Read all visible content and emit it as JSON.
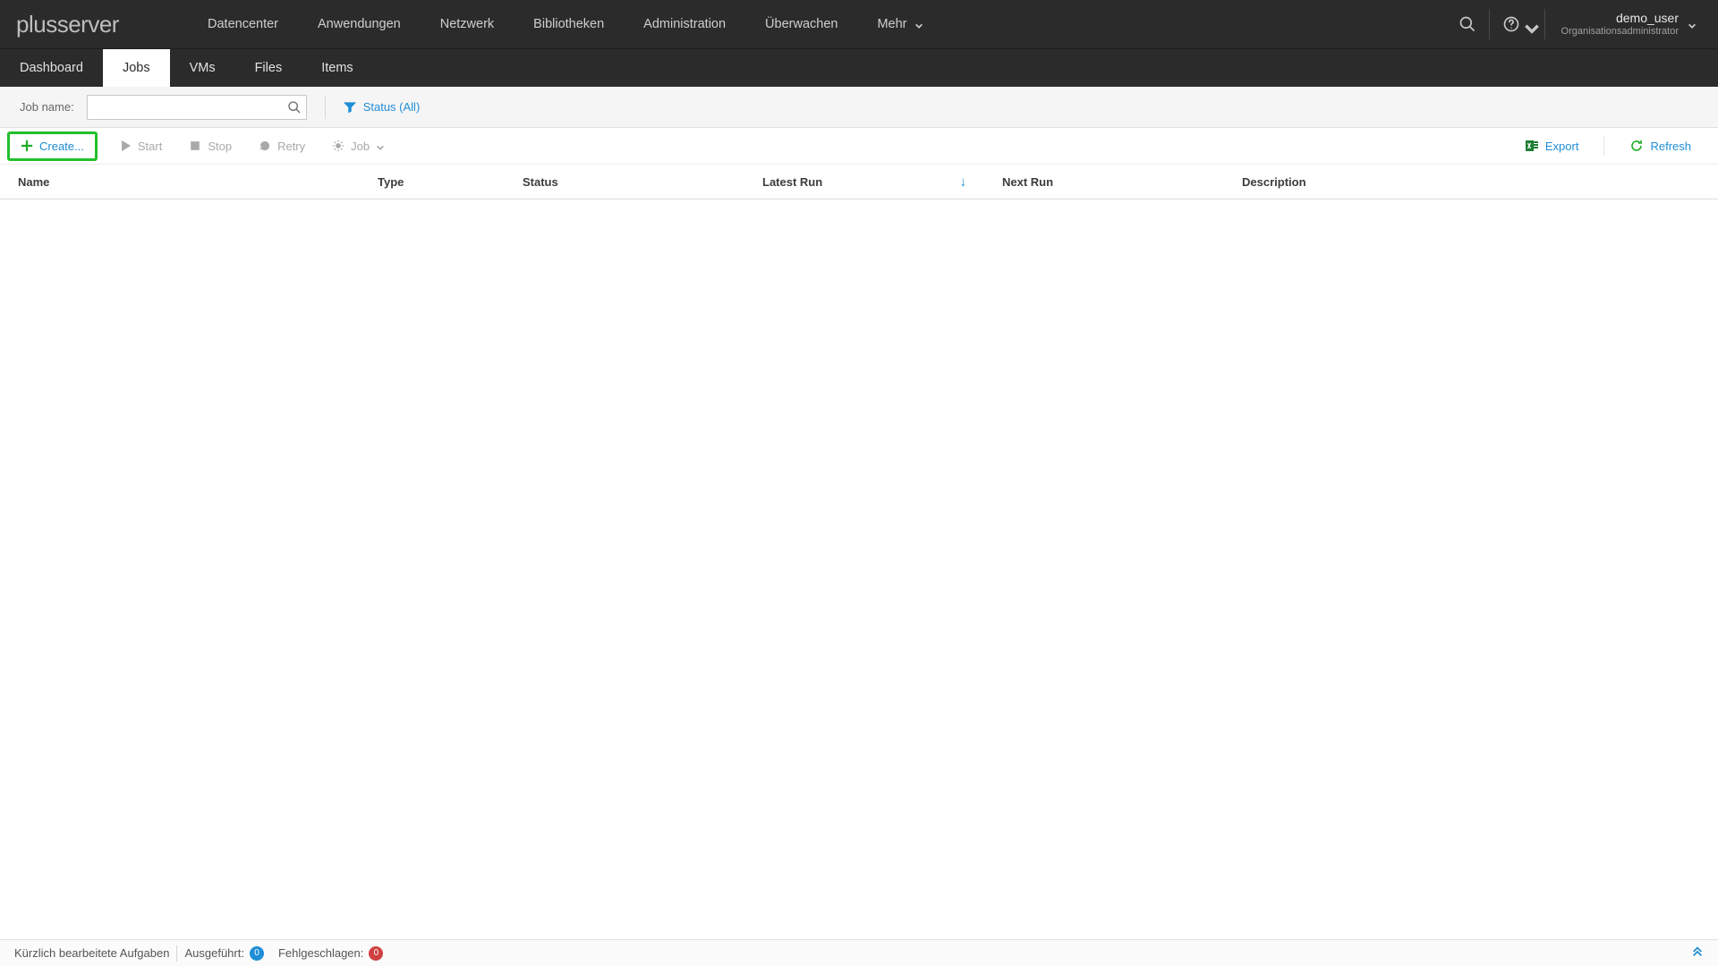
{
  "brand": "plusserver",
  "primary_nav": {
    "items": [
      "Datencenter",
      "Anwendungen",
      "Netzwerk",
      "Bibliotheken",
      "Administration",
      "Überwachen"
    ],
    "more_label": "Mehr"
  },
  "user": {
    "name": "demo_user",
    "role": "Organisationsadministrator"
  },
  "subtabs": {
    "items": [
      "Dashboard",
      "Jobs",
      "VMs",
      "Files",
      "Items"
    ],
    "active_index": 1
  },
  "filter": {
    "label": "Job name:",
    "search_value": "",
    "search_placeholder": "",
    "status_label": "Status (All)"
  },
  "toolbar": {
    "create": "Create...",
    "start": "Start",
    "stop": "Stop",
    "retry": "Retry",
    "job": "Job",
    "export": "Export",
    "refresh": "Refresh"
  },
  "columns": {
    "name": "Name",
    "type": "Type",
    "status": "Status",
    "latest_run": "Latest Run",
    "next_run": "Next Run",
    "description": "Description"
  },
  "status_bar": {
    "recent": "Kürzlich bearbeitete Aufgaben",
    "executed_label": "Ausgeführt:",
    "executed_count": "0",
    "failed_label": "Fehlgeschlagen:",
    "failed_count": "0"
  }
}
